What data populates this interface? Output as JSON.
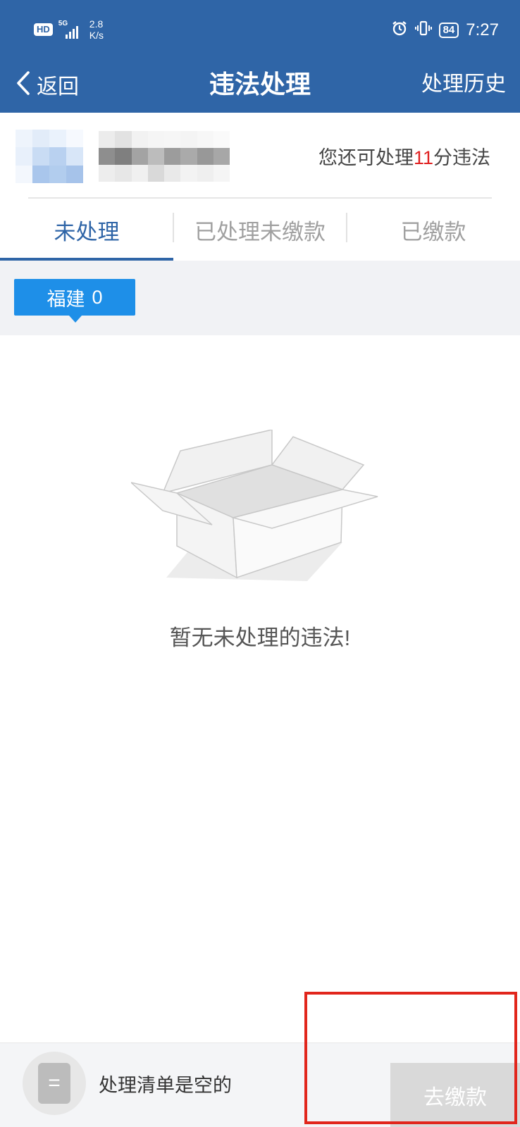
{
  "status_bar": {
    "hd": "HD",
    "network": "5G",
    "speed_value": "2.8",
    "speed_unit": "K/s",
    "battery": "84",
    "time": "7:27"
  },
  "nav": {
    "back_label": "返回",
    "title": "违法处理",
    "history_label": "处理历史"
  },
  "profile": {
    "quota_prefix": "您还可处理",
    "quota_number": "11",
    "quota_suffix": "分违法"
  },
  "tabs": [
    {
      "label": "未处理",
      "active": true
    },
    {
      "label": "已处理未缴款",
      "active": false
    },
    {
      "label": "已缴款",
      "active": false
    }
  ],
  "region": {
    "name": "福建",
    "count": "0"
  },
  "empty_state": {
    "message": "暂无未处理的违法!"
  },
  "bottom_bar": {
    "cart_text": "处理清单是空的",
    "pay_label": "去缴款"
  },
  "colors": {
    "header_blue": "#2f65a7",
    "chip_blue": "#1e8fe8",
    "accent_red": "#e02020",
    "highlight_red": "#e1261c"
  }
}
